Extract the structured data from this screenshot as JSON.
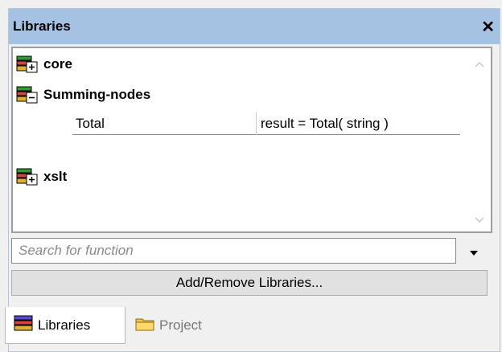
{
  "window": {
    "title": "Libraries",
    "close_glyph": "✕"
  },
  "tree": {
    "libraries": [
      {
        "name": "core",
        "expanded": false,
        "icon": "library-collapsed-icon"
      },
      {
        "name": "Summing-nodes",
        "expanded": true,
        "icon": "library-expanded-icon",
        "functions": [
          {
            "name": "Total",
            "signature": "result = Total( string )"
          }
        ]
      },
      {
        "name": "xslt",
        "expanded": false,
        "icon": "library-collapsed-icon"
      }
    ]
  },
  "search": {
    "placeholder": "Search for function"
  },
  "add_button": {
    "label": "Add/Remove Libraries..."
  },
  "tabs": [
    {
      "label": "Libraries",
      "active": true,
      "icon": "books-icon"
    },
    {
      "label": "Project",
      "active": false,
      "icon": "folder-icon"
    }
  ],
  "colors": {
    "titlebar": "#a6c2e2",
    "panel": "#f0f0f0"
  }
}
